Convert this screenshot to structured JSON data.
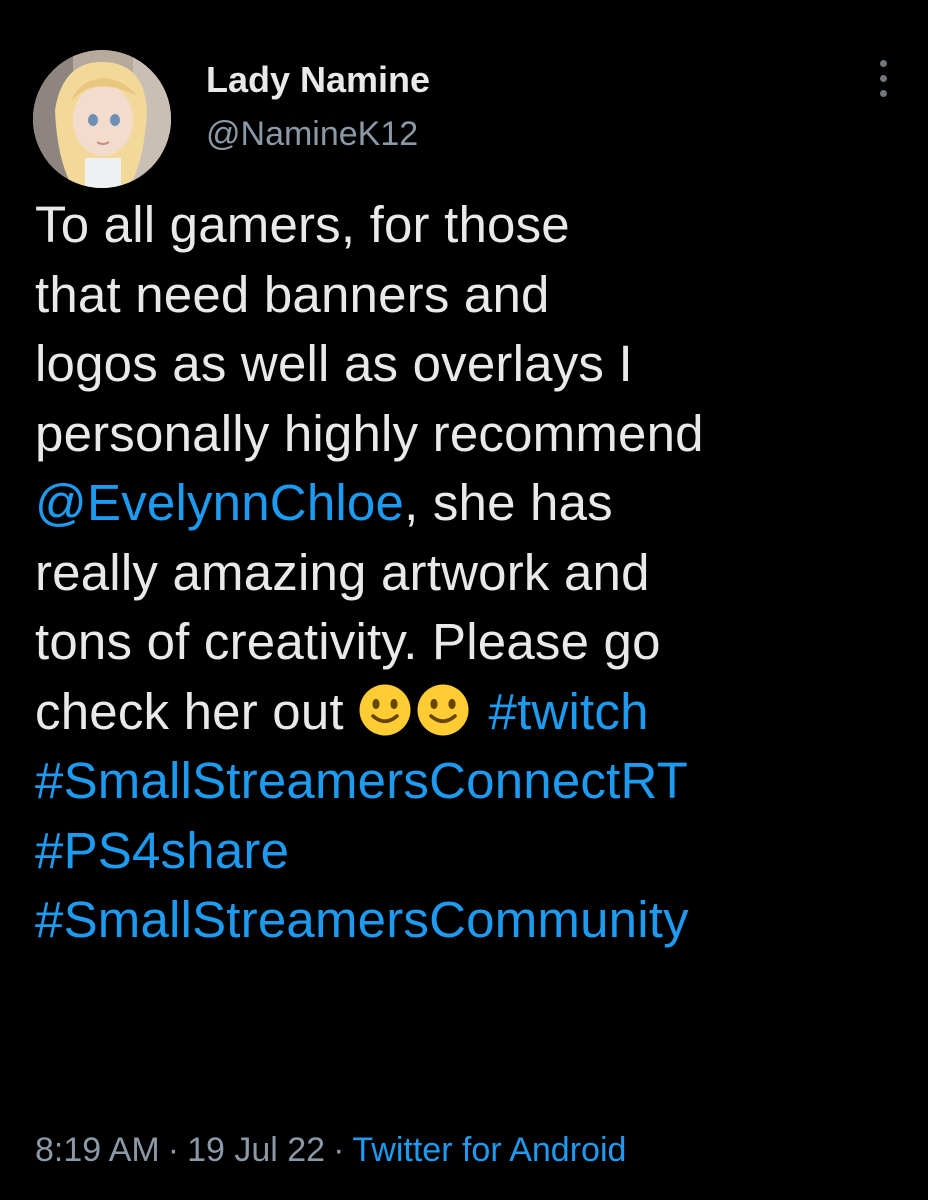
{
  "colors": {
    "background": "#000000",
    "text_primary": "#e7e9ea",
    "text_secondary": "#8b98a5",
    "link": "#1d9bf0",
    "emoji_face": "#ffcc33"
  },
  "author": {
    "display_name": "Lady Namine",
    "handle": "@NamineK12",
    "avatar_icon": "avatar-image"
  },
  "more_icon": "more-vertical-icon",
  "tweet": {
    "lines": {
      "l1": "To all gamers, for those",
      "l2": "that need banners and",
      "l3": "logos as well as overlays I",
      "l4": "personally highly recommend",
      "l5_mention": "@EvelynnChloe",
      "l5_text": ", she has",
      "l6": "really amazing artwork and",
      "l7": "tons of creativity. Please go",
      "l8_text": "check her out ",
      "l8_emoji": "slightly-smiling-face-icon",
      "l8_hashtag": "#twitch",
      "l9_hashtag": "#SmallStreamersConnectRT",
      "l10_hashtag": "#PS4share",
      "l11_hashtag": "#SmallStreamersCommunity"
    }
  },
  "meta": {
    "time": "8:19 AM",
    "separator": "·",
    "date": "19 Jul 22",
    "source": "Twitter for Android"
  }
}
